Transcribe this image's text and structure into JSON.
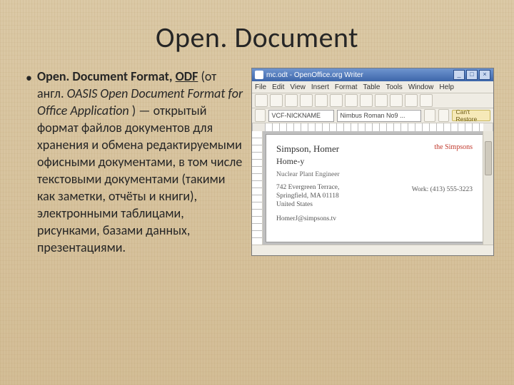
{
  "title": "Open. Document",
  "bullet": "•",
  "para": {
    "lead_bold": "Open. Document Format, ",
    "odf_bold_u": "ODF",
    "after_odf": " (от англ. ",
    "italic": "OASIS Open Document Format for Office Application",
    "after_italic": " ) — открытый формат файлов документов для хранения и обмена редактируемыми офисными документами, в том числе текстовыми документами (такими как заметки, отчёты и книги), электронными таблицами, рисунками, базами данных, презентациями."
  },
  "app": {
    "title": "mc.odt - OpenOffice.org Writer",
    "menus": [
      "File",
      "Edit",
      "View",
      "Insert",
      "Format",
      "Table",
      "Tools",
      "Window",
      "Help"
    ],
    "combo_style": "VCF-NICKNAME",
    "combo_font": "Nimbus Roman No9 ...",
    "badge": "Can't Restore",
    "doc": {
      "name": "Simpson, Homer",
      "sub": "Home-y",
      "role": "Nuclear Plant Engineer",
      "addr1": "742 Evergreen Terrace,",
      "addr2": "Springfield, MA 01118",
      "country": "United States",
      "email": "HomerJ@simpsons.tv",
      "group": "the Simpsons",
      "work": "Work: (413) 555-3223"
    }
  }
}
